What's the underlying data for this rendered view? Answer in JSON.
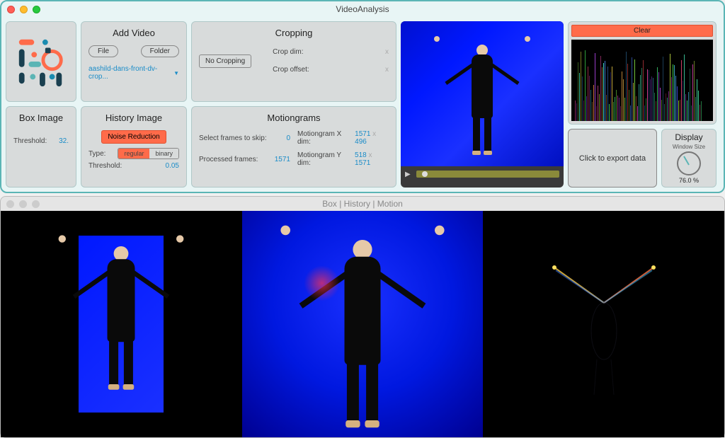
{
  "win1": {
    "title": "VideoAnalysis",
    "addVideo": {
      "heading": "Add Video",
      "fileBtn": "File",
      "folderBtn": "Folder",
      "dropdown": "aashild-dans-front-dv-crop..."
    },
    "cropping": {
      "heading": "Cropping",
      "noCroppingBtn": "No Cropping",
      "cropDimLabel": "Crop dim:",
      "cropDimX": "x",
      "cropOffsetLabel": "Crop offset:",
      "cropOffsetX": "x"
    },
    "boxImage": {
      "heading": "Box Image",
      "thresholdLabel": "Threshold:",
      "thresholdVal": "32."
    },
    "history": {
      "heading": "History Image",
      "noiseBtn": "Noise Reduction",
      "typeLabel": "Type:",
      "regular": "regular",
      "binary": "binary",
      "thresholdLabel": "Threshold:",
      "thresholdVal": "0.05"
    },
    "motiongrams": {
      "heading": "Motiongrams",
      "selectFramesLabel": "Select frames to skip:",
      "selectFramesVal": "0",
      "processedLabel": "Processed frames:",
      "processedVal": "1571",
      "mxLabel": "Motiongram X dim:",
      "mxA": "1571",
      "mxX": "x",
      "mxB": "496",
      "myLabel": "Motiongram Y dim:",
      "myA": "518",
      "myX": "x",
      "myB": "1571"
    },
    "right": {
      "clear": "Clear",
      "export": "Click to export data",
      "display": "Display",
      "windowSize": "Window Size",
      "percent": "76.0 %"
    }
  },
  "win2": {
    "title": "Box | History | Motion"
  }
}
